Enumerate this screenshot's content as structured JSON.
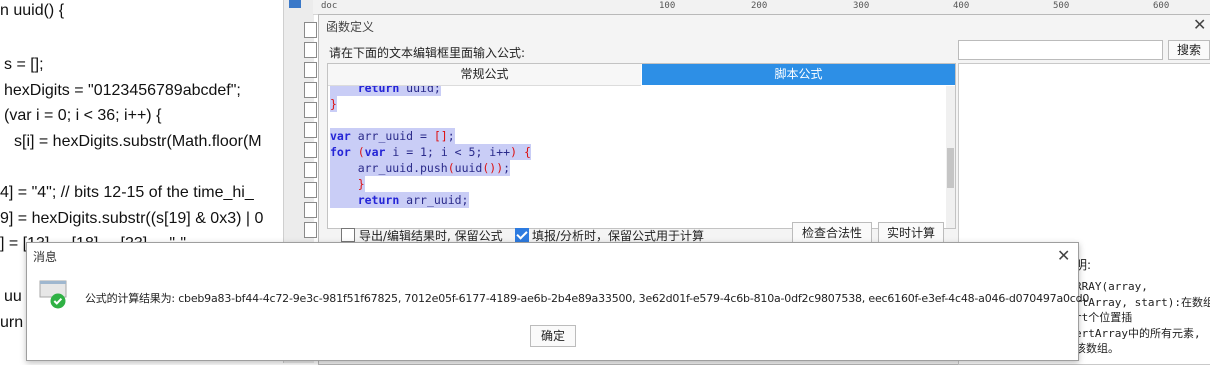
{
  "background_code": {
    "lines": [
      "n uuid() {",
      "s = [];",
      "hexDigits = \"0123456789abcdef\";",
      "(var i = 0; i < 36; i++) {",
      "s[i] = hexDigits.substr(Math.floor(M",
      "4] = \"4\"; // bits 12-15 of the time_hi_",
      "9] = hexDigits.substr((s[19] & 0x3) | 0",
      "] = [13]     [18]     [23]     \"-\"",
      "uu",
      "urn"
    ]
  },
  "top_strip": {
    "folder_label": "doc",
    "ruler_ticks": [
      "100",
      "200",
      "300",
      "400",
      "500",
      "600"
    ]
  },
  "function_dialog": {
    "title": "函数定义",
    "close_glyph": "✕",
    "instruction": "请在下面的文本编辑框里面输入公式:",
    "tabs": {
      "regular": "常规公式",
      "script": "脚本公式"
    },
    "code_lines": [
      "    return uuid;",
      "}",
      "",
      "var arr_uuid = [];",
      "for (var i = 1; i < 5; i++) {",
      "    arr_uuid.push(uuid());",
      "    }",
      "    return arr_uuid;"
    ],
    "options": {
      "export_keep_formula": {
        "label": "导出/编辑结果时, 保留公式",
        "checked": false
      },
      "fill_keep_formula": {
        "label": "填报/分析时，保留公式用于计算",
        "checked": true
      }
    },
    "buttons": {
      "check_validity": "检查合法性",
      "realtime_calc": "实时计算"
    },
    "search": {
      "placeholder": "",
      "button": "搜索"
    },
    "description": {
      "label": "明:",
      "lines": [
        "RRAY(array,",
        "rtArray, start):在数组",
        "rt个位置插",
        "ertArray中的所有元素,",
        "该数组。"
      ]
    }
  },
  "message_dialog": {
    "title": "消息",
    "close_glyph": "✕",
    "result_text": "公式的计算结果为: cbeb9a83-bf44-4c72-9e3c-981f51f67825, 7012e05f-6177-4189-ae6b-2b4e89a33500, 3e62d01f-e579-4c6b-810a-0df2c9807538, eec6160f-e3ef-4c48-a046-d070497a0cd0",
    "ok_button": "确定",
    "status": "success"
  },
  "colors": {
    "accent_tab": "#2d8fe6",
    "code_highlight": "#c9cdf6",
    "keyword": "#2424d6",
    "success_icon": "#2fb144"
  }
}
